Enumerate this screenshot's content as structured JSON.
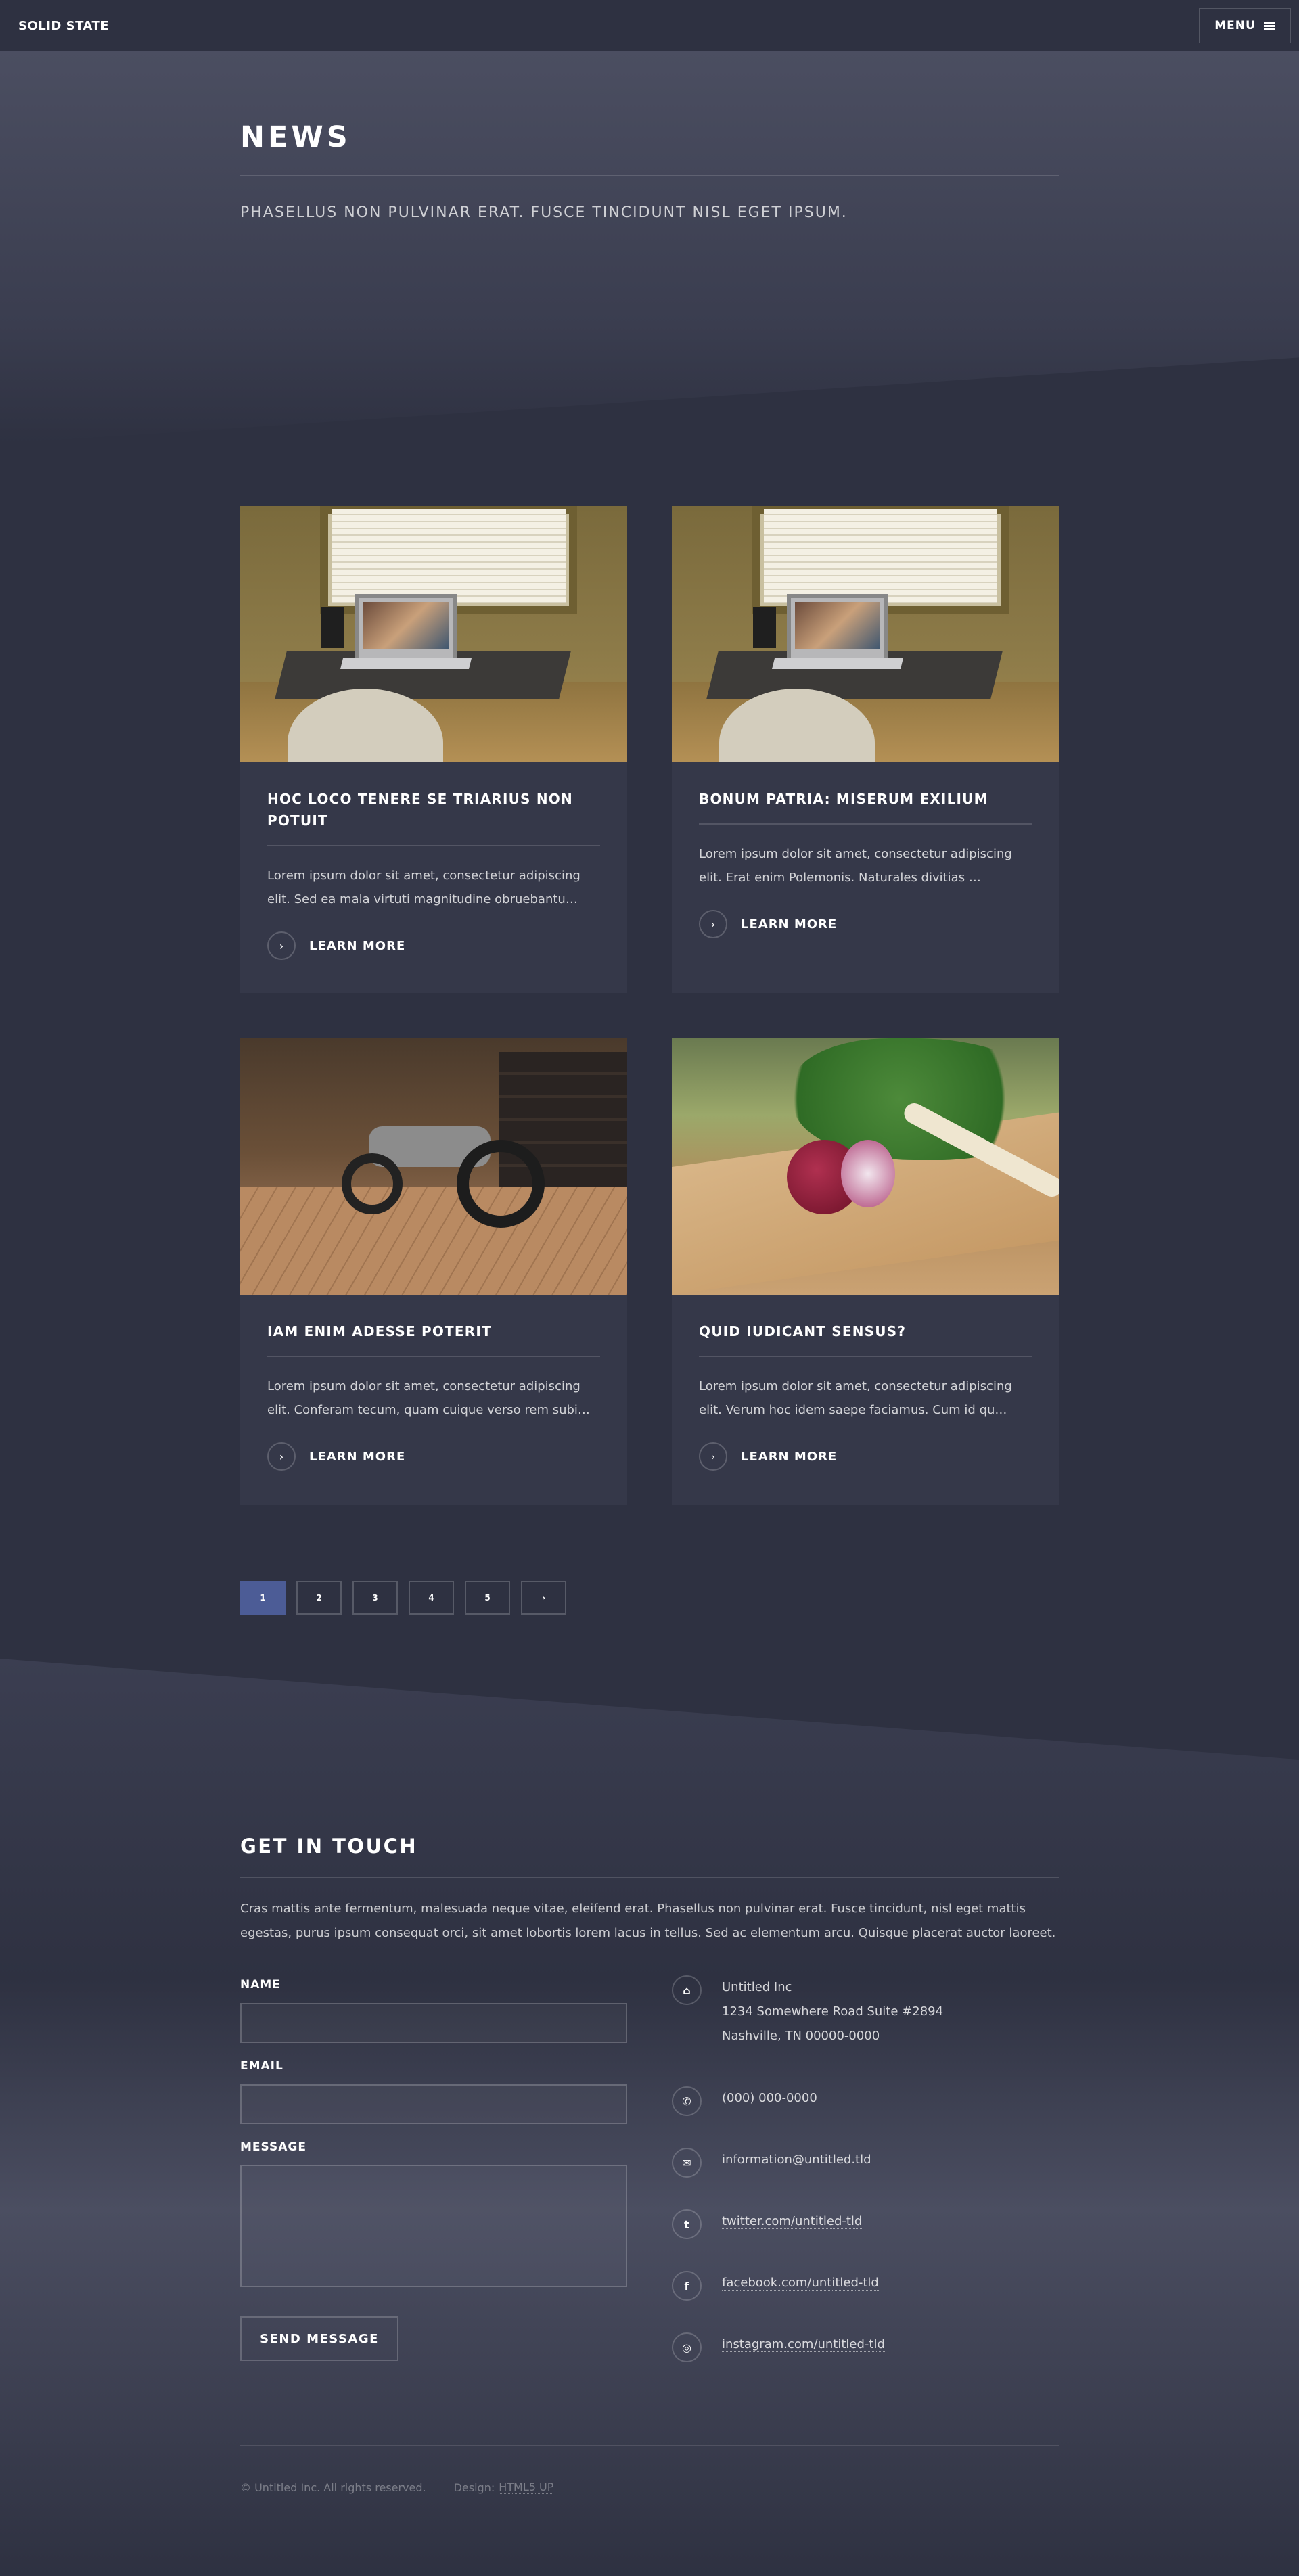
{
  "header": {
    "logo": "SOLID STATE",
    "menu_label": "MENU"
  },
  "banner": {
    "title": "NEWS",
    "subtitle": "PHASELLUS NON PULVINAR ERAT. FUSCE TINCIDUNT NISL EGET IPSUM."
  },
  "articles": [
    {
      "title": "HOC LOCO TENERE SE TRIARIUS NON POTUIT",
      "text": "Lorem ipsum dolor sit amet, consectetur adipiscing elit. Sed ea mala virtuti magnitudine obruebantu…",
      "cta": "LEARN MORE"
    },
    {
      "title": "BONUM PATRIA: MISERUM EXILIUM",
      "text": "Lorem ipsum dolor sit amet, consectetur adipiscing elit. Erat enim Polemonis. Naturales divitias …",
      "cta": "LEARN MORE"
    },
    {
      "title": "IAM ENIM ADESSE POTERIT",
      "text": "Lorem ipsum dolor sit amet, consectetur adipiscing elit. Conferam tecum, quam cuique verso rem subi…",
      "cta": "LEARN MORE"
    },
    {
      "title": "QUID IUDICANT SENSUS?",
      "text": "Lorem ipsum dolor sit amet, consectetur adipiscing elit. Verum hoc idem saepe faciamus. Cum id qu…",
      "cta": "LEARN MORE"
    }
  ],
  "pagination": {
    "pages": [
      "1",
      "2",
      "3",
      "4",
      "5"
    ],
    "next": "›",
    "active": "1"
  },
  "footer": {
    "title": "GET IN TOUCH",
    "intro": "Cras mattis ante fermentum, malesuada neque vitae, eleifend erat. Phasellus non pulvinar erat. Fusce tincidunt, nisl eget mattis egestas, purus ipsum consequat orci, sit amet lobortis lorem lacus in tellus. Sed ac elementum arcu. Quisque placerat auctor laoreet.",
    "form": {
      "name_label": "NAME",
      "email_label": "EMAIL",
      "message_label": "MESSAGE",
      "send_label": "SEND MESSAGE"
    },
    "contact": {
      "company": "Untitled Inc",
      "street": "1234 Somewhere Road Suite #2894",
      "city": "Nashville, TN 00000-0000",
      "phone": "(000) 000-0000",
      "email": "information@untitled.tld",
      "twitter": "twitter.com/untitled-tld",
      "facebook": "facebook.com/untitled-tld",
      "instagram": "instagram.com/untitled-tld"
    },
    "copyright": "© Untitled Inc. All rights reserved.",
    "design_label": "Design:",
    "design_link": "HTML5 UP"
  }
}
